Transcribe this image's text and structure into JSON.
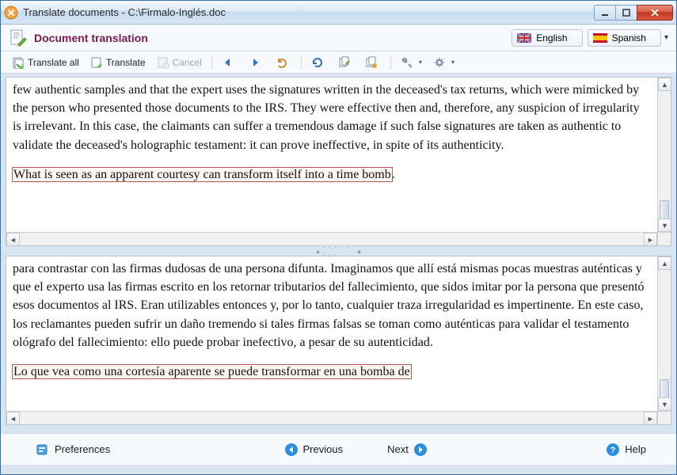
{
  "window": {
    "title": "Translate documents - C:\\Firmalo-Inglés.doc"
  },
  "header": {
    "title": "Document translation",
    "source_lang": "English",
    "target_lang": "Spanish"
  },
  "toolbar": {
    "translate_all": "Translate all",
    "translate": "Translate",
    "cancel": "Cancel"
  },
  "source": {
    "para1": "few authentic samples and that the expert uses the signatures written in the deceased's tax returns, which were mimicked by the person who presented those documents to the IRS. They were effective then and, therefore, any suspicion of irregularity is irrelevant. In this case, the claimants can suffer a tremendous damage if such false signatures are taken as authentic to validate the deceased's holographic testament: it can prove ineffective, in spite of its authenticity.",
    "para2_hl": "What is seen as an apparent courtesy can transform itself into a time bomb",
    "para2_after": "."
  },
  "target": {
    "para1": "para contrastar con las firmas dudosas de una persona difunta. Imaginamos que allí está mismas pocas muestras auténticas y que el experto usa las firmas escrito en los retornar tributarios del fallecimiento, que sidos imitar por la persona que presentó esos documentos al IRS. Eran utilizables entonces y, por lo tanto, cualquier traza irregularidad es impertinente. En este caso, los reclamantes pueden sufrir un daño tremendo si tales firmas falsas se toman como auténticas para validar el testamento ológrafo del fallecimiento: ello puede probar inefectivo, a pesar de su autenticidad.",
    "para2_hl": "Lo que vea como una cortesía aparente se puede transformar en una bomba de"
  },
  "footer": {
    "preferences": "Preferences",
    "previous": "Previous",
    "next": "Next",
    "help": "Help"
  },
  "icons": {
    "app": "app-icon",
    "doc": "doc-edit-icon"
  }
}
